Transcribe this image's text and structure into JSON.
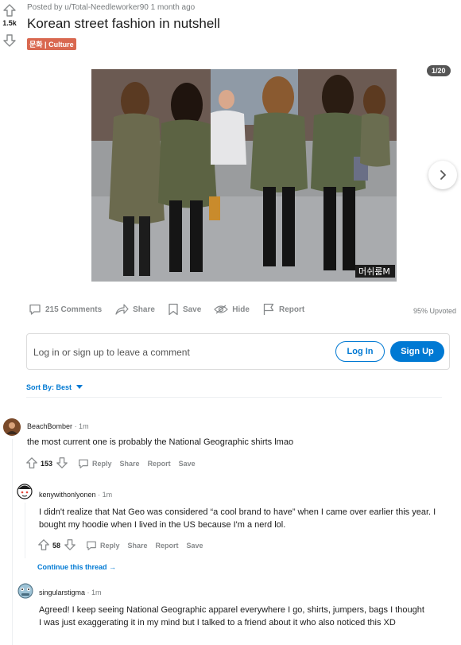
{
  "post": {
    "posted_by": "Posted by u/Total-Needleworker90 1 month ago",
    "score": "1.5k",
    "title": "Korean street fashion in nutshell",
    "flair": "문화 | Culture",
    "gallery_counter": "1/20",
    "watermark": "머쉬룸M"
  },
  "actions": {
    "comments": "215 Comments",
    "share": "Share",
    "save": "Save",
    "hide": "Hide",
    "report": "Report",
    "upvoted": "95% Upvoted"
  },
  "comment_box": {
    "placeholder": "Log in or sign up to leave a comment",
    "login": "Log In",
    "signup": "Sign Up"
  },
  "sort": {
    "label": "Sort By: Best"
  },
  "comments": [
    {
      "user": "BeachBomber",
      "time": "· 1m",
      "text": "the most current one is probably the National Geographic shirts lmao",
      "score": "153",
      "reply": "Reply",
      "share": "Share",
      "report": "Report",
      "save": "Save"
    },
    {
      "user": "kenywithonlyonen",
      "time": "· 1m",
      "text": "I didn't realize that Nat Geo was considered “a cool brand to have” when I came over earlier this year. I bought my hoodie when I lived in the US because I'm a nerd lol.",
      "score": "58",
      "reply": "Reply",
      "share": "Share",
      "report": "Report",
      "save": "Save"
    },
    {
      "user": "singularstigma",
      "time": "· 1m",
      "text": "Agreed! I keep seeing National Geographic apparel everywhere I go, shirts, jumpers, bags I thought I was just exaggerating it in my mind but I talked to a friend about it who also noticed this XD"
    }
  ],
  "continue_thread": "Continue this thread",
  "colors": {
    "accent": "#0079d3",
    "flair": "#d96850"
  }
}
